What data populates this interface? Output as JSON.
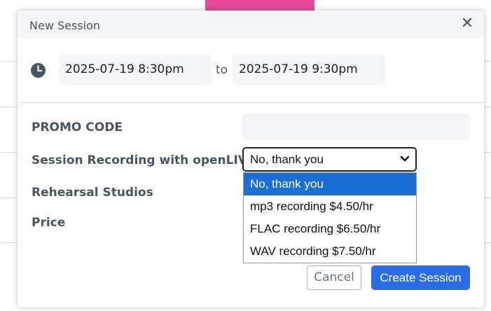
{
  "modal": {
    "title": "New Session",
    "close_label": "✕"
  },
  "time_range": {
    "start": "2025-07-19 8:30pm",
    "separator": "to",
    "end": "2025-07-19 9:30pm"
  },
  "form": {
    "promo_label": "PROMO CODE",
    "promo_value": "",
    "recording_label": "Session Recording with openLIVE",
    "recording_selected": "No, thank you",
    "recording_options": [
      "No, thank you",
      "mp3 recording $4.50/hr",
      "FLAC recording $6.50/hr",
      "WAV recording $7.50/hr"
    ],
    "studios_label": "Rehearsal Studios",
    "price_label": "Price"
  },
  "actions": {
    "cancel_label": "Cancel",
    "create_label": "Create Session"
  },
  "colors": {
    "accent": "#2a6be6",
    "selected_option": "#1a6fd6",
    "header_bg": "#f3f5f8",
    "brand_pink": "#e44a96"
  }
}
